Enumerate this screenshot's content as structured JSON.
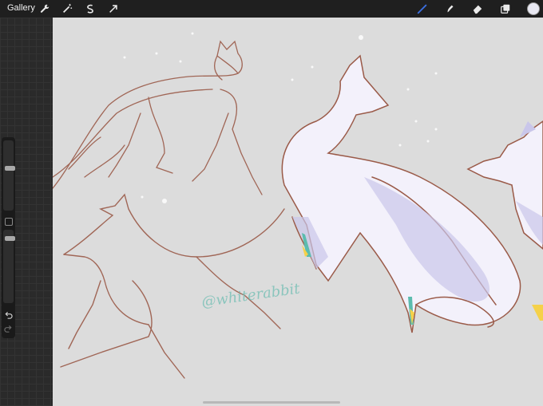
{
  "toolbar": {
    "gallery_label": "Gallery",
    "left_tools": [
      "wrench-icon",
      "magic-wand-icon",
      "selection-icon",
      "transform-arrow-icon"
    ],
    "right_tools": [
      "brush-icon",
      "smudge-icon",
      "eraser-icon",
      "layers-icon"
    ],
    "current_color": "#e8e8f2",
    "active_tool_color": "#3b6fe0"
  },
  "sidebar": {
    "brush_size_level": 0.3,
    "opacity_level": 0.18,
    "controls": [
      "size-slider",
      "modify-button",
      "opacity-slider",
      "undo-icon",
      "redo-icon"
    ]
  },
  "canvas": {
    "background_color": "#dcdcdc",
    "sketch_stroke_color": "#9a5a48",
    "fox_fill_color": "#f3f1fb",
    "fox_shadow_color": "#c9c6ea",
    "watermark_text": "@whiterabbit"
  }
}
